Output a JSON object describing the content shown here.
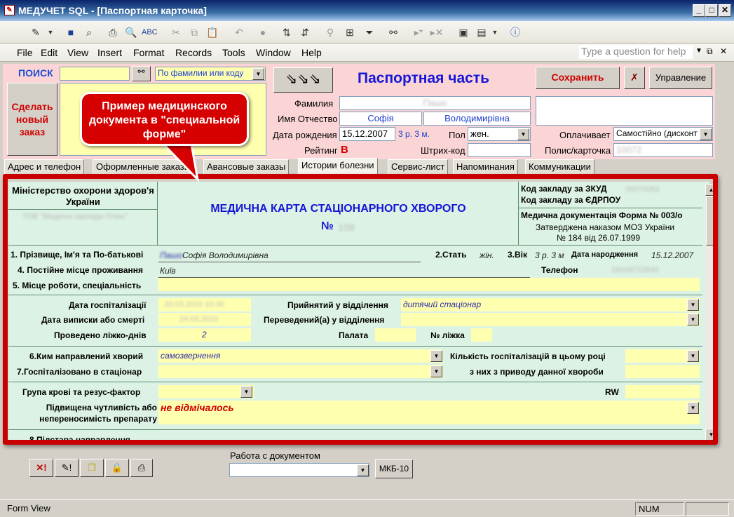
{
  "window": {
    "title": "МЕДУЧЕТ SQL - [Паспортная карточка]"
  },
  "menu": {
    "items": [
      "File",
      "Edit",
      "View",
      "Insert",
      "Format",
      "Records",
      "Tools",
      "Window",
      "Help"
    ],
    "ask_placeholder": "Type a question for help"
  },
  "search": {
    "label": "ПОИСК",
    "mode": "По фамилии или коду"
  },
  "new_order_button": "Сделать новый заказ",
  "section_title": "Паспортная часть",
  "save_button": "Сохранить",
  "manage_button": "Управление",
  "patient": {
    "surname_label": "Фамилия",
    "surname_value": "Пашо",
    "name_label": "Имя Отчество",
    "first_name": "Софія",
    "patronymic": "Володимирівна",
    "dob_label": "Дата рождения",
    "dob": "15.12.2007",
    "age": "3 р. 3 м.",
    "sex_label": "Пол",
    "sex": "жен.",
    "rating_label": "Рейтинг",
    "rating": "B",
    "barcode_label": "Штрих-код",
    "payer_label": "Оплачивает",
    "payer": "Самостійно (дисконт",
    "policy_label": "Полис/карточка",
    "policy": "10072"
  },
  "callout": "Пример медицинского документа в \"специальной форме\"",
  "tabs": [
    "Адрес и телефон",
    "Оформленные заказы",
    "Авансовые заказы",
    "Истории болезни",
    "Сервис-лист",
    "Напоминания",
    "Коммуникации"
  ],
  "doc": {
    "ministry": "Міністерство охорони здоров'я України",
    "ministry_sub": "ТОВ \"Медичні заклади Плюс\"",
    "card_title": "МЕДИЧНА КАРТА СТАЦІОНАРНОГО ХВОРОГО",
    "card_no_label": "№",
    "card_no": "108",
    "zkud_label": "Код закладу за ЗКУД",
    "zkud_value": "00070062",
    "edrpou_label": "Код закладу за ЄДРПОУ",
    "form_label": "Медична документація Форма № 003/о",
    "approved": "Затверджена наказом МОЗ України",
    "approved2": "№ 184 від 26.07.1999",
    "f1_label": "1. Прізвище, Ім'я та По-батькові",
    "f1_value": "Софія Володимирівна",
    "f1_blur": "Пашо",
    "sex_label": "2.Стать",
    "sex_value": "жін.",
    "age_label": "3.Вік",
    "age_value": "3 р. 3 м",
    "dob_label": "Дата народження",
    "dob_value": "15.12.2007",
    "f4_label": "4. Постійне місце проживання",
    "f4_value": "Київ",
    "phone_label": "Телефон",
    "phone_value": "18008722840",
    "f5_label": "5. Місце роботи, спеціальність",
    "hosp_date_label": "Дата госпіталізації",
    "hosp_date": "20.03.2010 10:30",
    "dept_in_label": "Прийнятий у відділення",
    "dept_in": "дитячий стаціонар",
    "discharge_label": "Дата виписки або смерті",
    "discharge": "24.03.2010",
    "dept_trans_label": "Переведений(а) у відділення",
    "bed_days_label": "Проведено ліжко-днів",
    "bed_days": "2",
    "ward_label": "Палата",
    "bed_label": "№ ліжка",
    "f6_label": "6.Ким направлений хворий",
    "f6_value": "самозвернення",
    "count_label": "Кількість госпіталізацій в цьому році",
    "f7_label": "7.Госпіталізовано в стаціонар",
    "count2_label": "з них з приводу данної хвороби",
    "blood_label": "Група крові та резус-фактор",
    "rw_label": "RW",
    "allergy_label": "Підвищена чутливість або непереносимість препарату",
    "allergy_value": "не  відмічалось",
    "f8_label": "8.Підстава направлення"
  },
  "bottom": {
    "doc_work_label": "Работа с документом",
    "mkb_button": "МКБ-10"
  },
  "status": {
    "mode": "Form View",
    "num": "NUM"
  }
}
